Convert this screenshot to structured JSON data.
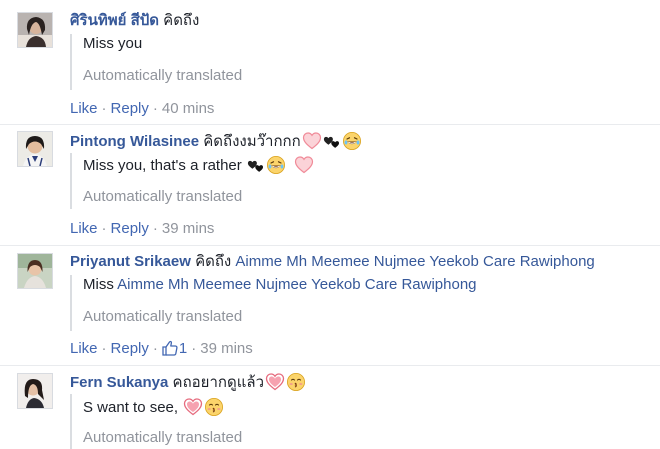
{
  "comments": [
    {
      "author": "ศิรินทิพย์ สีปัด",
      "text": "คิดถึง",
      "translation": "Miss you",
      "translated_label": "Automatically translated",
      "like_label": "Like",
      "reply_label": "Reply",
      "time": "40 mins"
    },
    {
      "author": "Pintong Wilasinee",
      "text": "คิดถึงงมว๊ากกก",
      "translation": "Miss you, that's a rather",
      "translated_label": "Automatically translated",
      "like_label": "Like",
      "reply_label": "Reply",
      "time": "39 mins"
    },
    {
      "author": "Priyanut Srikaew",
      "text": "คิดถึง",
      "tagged": "Aimme Mh Meemee Nujmee Yeekob Care Rawiphong",
      "translation_prefix": "Miss",
      "translation_tagged": "Aimme Mh Meemee Nujmee Yeekob Care Rawiphong",
      "translated_label": "Automatically translated",
      "like_label": "Like",
      "reply_label": "Reply",
      "like_count": "1",
      "time": "39 mins"
    },
    {
      "author": "Fern Sukanya",
      "text": "คถอยากดูแล้ว",
      "translation": "S want to see,",
      "translated_label": "Automatically translated"
    }
  ],
  "separator": "·",
  "icons": {
    "heart": "heart-icon",
    "black_hearts": "black-hearts-icon",
    "laugh": "laughing-face-icon",
    "kiss": "kissing-face-icon",
    "thumb": "thumbs-up-icon"
  },
  "colors": {
    "link": "#365899",
    "action": "#4267b2",
    "muted": "#90949c",
    "text": "#1d2129"
  }
}
